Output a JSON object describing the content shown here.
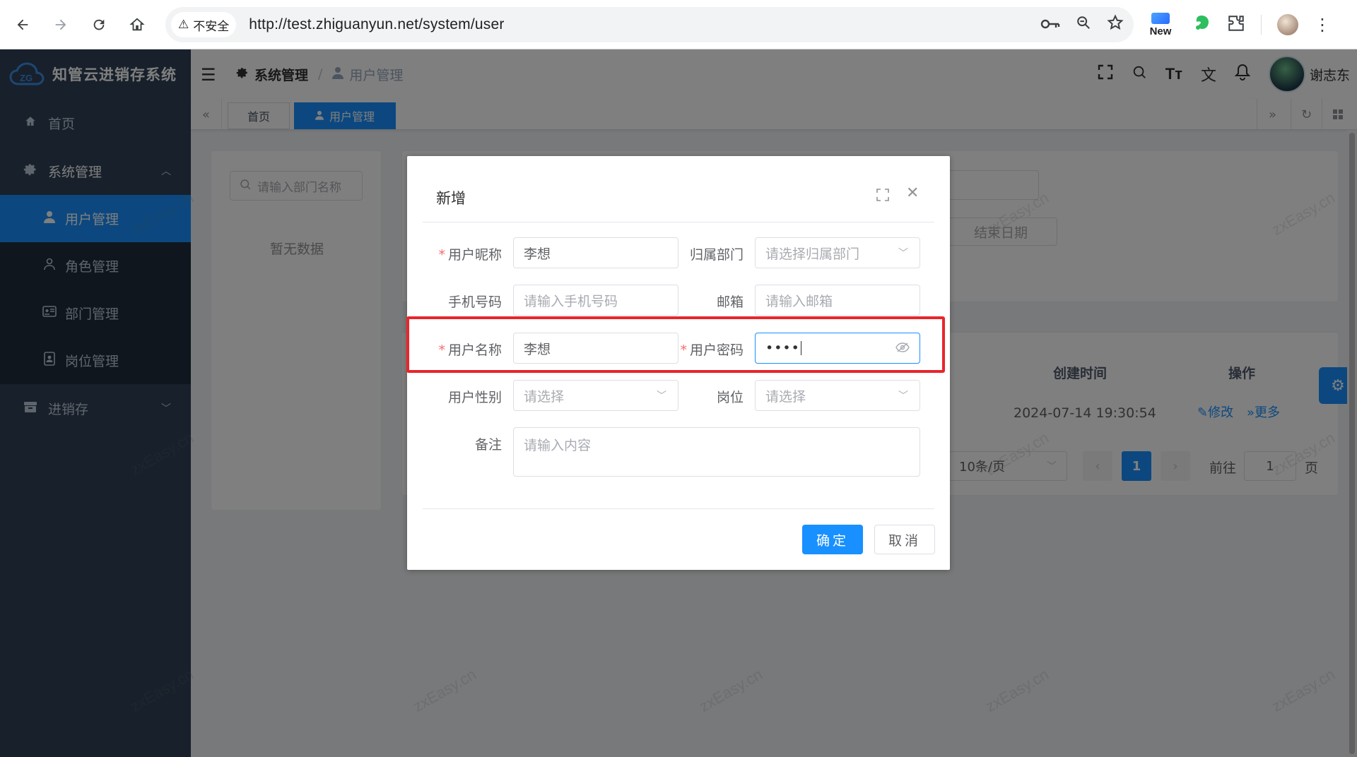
{
  "browser": {
    "security_label": "不安全",
    "url": "http://test.zhiguanyun.net/system/user",
    "ext_new_label": "New"
  },
  "app": {
    "title": "知管云进销存系统"
  },
  "sidebar": {
    "items": [
      {
        "label": "首页"
      },
      {
        "label": "系统管理"
      },
      {
        "label": "进销存"
      }
    ],
    "sub_items": [
      {
        "label": "用户管理"
      },
      {
        "label": "角色管理"
      },
      {
        "label": "部门管理"
      },
      {
        "label": "岗位管理"
      }
    ]
  },
  "navbar": {
    "breadcrumb_parent": "系统管理",
    "breadcrumb_sep": "/",
    "breadcrumb_current": "用户管理",
    "user_name": "谢志东"
  },
  "tags": [
    {
      "label": "首页"
    },
    {
      "label": "用户管理"
    }
  ],
  "page": {
    "dept_search_placeholder": "请输入部门名称",
    "dept_empty": "暂无数据",
    "end_date_placeholder": "结束日期",
    "col_created": "创建时间",
    "col_actions": "操作",
    "row_created": "2024-07-14 19:30:54",
    "action_edit": "修改",
    "action_more": "更多",
    "page_size": "10条/页",
    "current_page": "1",
    "goto_label": "前往",
    "goto_value": "1",
    "goto_suffix": "页"
  },
  "watermark": "zxEasy.cn",
  "dialog": {
    "title": "新增",
    "fields": {
      "nickname_label": "用户昵称",
      "nickname_value": "李想",
      "dept_label": "归属部门",
      "dept_placeholder": "请选择归属部门",
      "phone_label": "手机号码",
      "phone_placeholder": "请输入手机号码",
      "email_label": "邮箱",
      "email_placeholder": "请输入邮箱",
      "username_label": "用户名称",
      "username_value": "李想",
      "password_label": "用户密码",
      "password_value": "••••",
      "gender_label": "用户性别",
      "gender_placeholder": "请选择",
      "post_label": "岗位",
      "post_placeholder": "请选择",
      "remark_label": "备注",
      "remark_placeholder": "请输入内容"
    },
    "ok_label": "确定",
    "cancel_label": "取消"
  }
}
